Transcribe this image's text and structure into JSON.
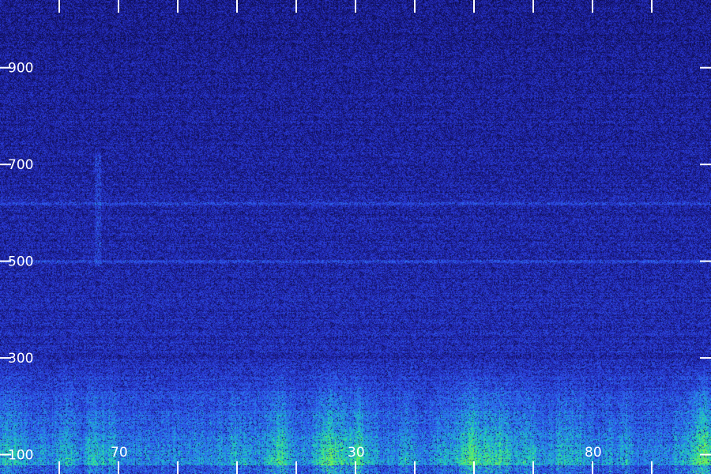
{
  "chart_data": {
    "type": "heatmap",
    "title": "",
    "xlabel": "",
    "ylabel": "",
    "colormap": [
      "#0a0a3a",
      "#1a1a8c",
      "#2a3ad8",
      "#2f6bf0",
      "#1fb0d8",
      "#23e0a0",
      "#7bf050"
    ],
    "background_color": "#0a0a3a",
    "y_ticks": [
      {
        "value": 100,
        "label": "100"
      },
      {
        "value": 300,
        "label": "300"
      },
      {
        "value": 500,
        "label": "500"
      },
      {
        "value": 700,
        "label": "700"
      },
      {
        "value": 900,
        "label": "900"
      }
    ],
    "ylim": [
      60,
      1040
    ],
    "x_tick_count": 12,
    "x_tick_labels": [
      {
        "index": 2,
        "label": "70"
      },
      {
        "index": 6,
        "label": "30"
      },
      {
        "index": 10,
        "label": "80"
      }
    ],
    "features": [
      {
        "kind": "low-frequency energy band",
        "y_range": [
          80,
          180
        ],
        "intensity": "high"
      },
      {
        "kind": "horizontal line",
        "y": 500,
        "intensity": "medium"
      },
      {
        "kind": "horizontal line",
        "y": 620,
        "intensity": "medium"
      },
      {
        "kind": "vertical streak",
        "x_index": 1.65,
        "y_range": [
          490,
          720
        ]
      }
    ]
  }
}
